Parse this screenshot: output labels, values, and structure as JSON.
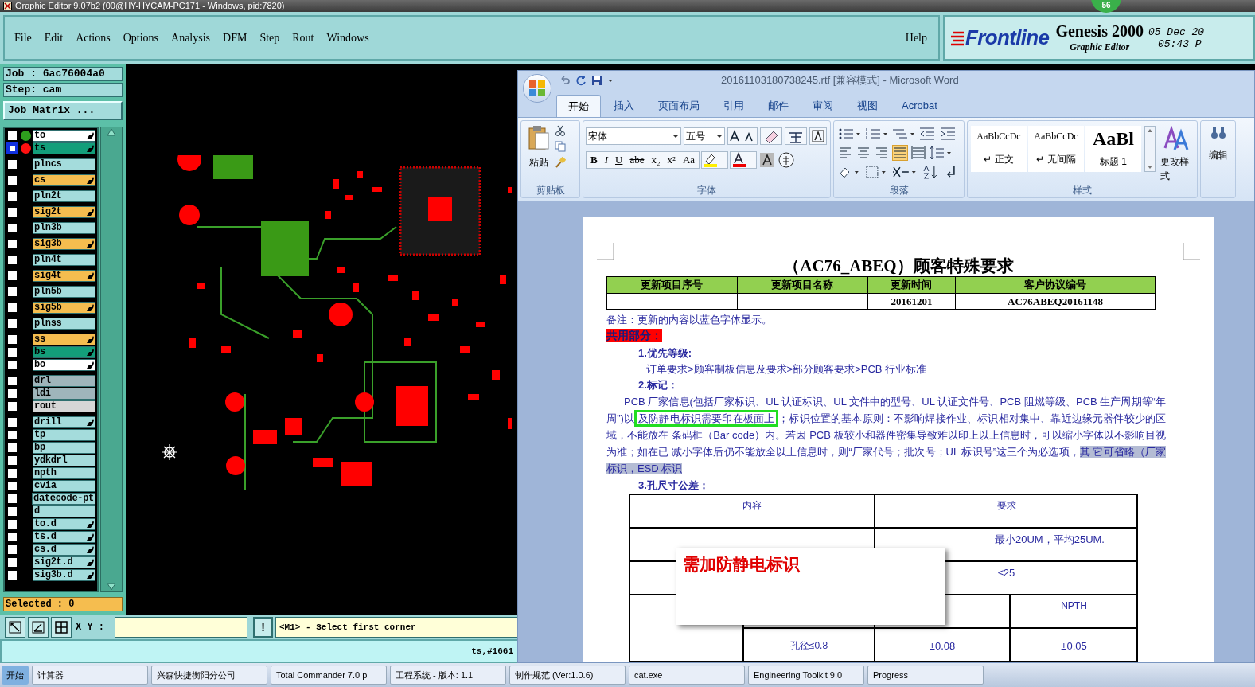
{
  "window": {
    "title": "Graphic Editor 9.07b2 (00@HY-HYCAM-PC171 - Windows, pid:7820)"
  },
  "menu": [
    "File",
    "Edit",
    "Actions",
    "Options",
    "Analysis",
    "DFM",
    "Step",
    "Rout",
    "Windows"
  ],
  "help": "Help",
  "brand": {
    "logo": "Frontline",
    "product": "Genesis 2000",
    "subtitle": "Graphic Editor",
    "date": "05 Dec 20",
    "time": "05:43 P",
    "badge": "56"
  },
  "job": "Job : 6ac76004a0",
  "step": "Step: cam",
  "job_matrix_button": "Job Matrix ...",
  "layer_groups": [
    {
      "layers": [
        {
          "name": "to",
          "kind": "silk",
          "color": "#2e9e1e",
          "flag": true,
          "selected": false
        },
        {
          "name": "ts",
          "kind": "mask",
          "color": "#ff1010",
          "flag": true,
          "selected": true
        }
      ]
    },
    {
      "layers": [
        {
          "name": "plncs",
          "kind": "plane",
          "flag": false,
          "selected": false
        }
      ]
    },
    {
      "layers": [
        {
          "name": "cs",
          "kind": "signal",
          "flag": true,
          "selected": false
        }
      ]
    },
    {
      "layers": [
        {
          "name": "pln2t",
          "kind": "plane",
          "flag": false,
          "selected": false
        }
      ]
    },
    {
      "layers": [
        {
          "name": "sig2t",
          "kind": "signal",
          "flag": true,
          "selected": false
        }
      ]
    },
    {
      "layers": [
        {
          "name": "pln3b",
          "kind": "plane",
          "flag": false,
          "selected": false
        }
      ]
    },
    {
      "layers": [
        {
          "name": "sig3b",
          "kind": "signal",
          "flag": true,
          "selected": false
        }
      ]
    },
    {
      "layers": [
        {
          "name": "pln4t",
          "kind": "plane",
          "flag": false,
          "selected": false
        }
      ]
    },
    {
      "layers": [
        {
          "name": "sig4t",
          "kind": "signal",
          "flag": true,
          "selected": false
        }
      ]
    },
    {
      "layers": [
        {
          "name": "pln5b",
          "kind": "plane",
          "flag": false,
          "selected": false
        }
      ]
    },
    {
      "layers": [
        {
          "name": "sig5b",
          "kind": "signal",
          "flag": true,
          "selected": false
        }
      ]
    },
    {
      "layers": [
        {
          "name": "plnss",
          "kind": "plane",
          "flag": false,
          "selected": false
        }
      ]
    },
    {
      "layers": [
        {
          "name": "ss",
          "kind": "signal",
          "flag": true,
          "selected": false
        },
        {
          "name": "bs",
          "kind": "mask",
          "flag": true,
          "selected": false
        },
        {
          "name": "bo",
          "kind": "silk",
          "flag": true,
          "selected": false
        }
      ]
    },
    {
      "layers": [
        {
          "name": "drl",
          "kind": "laser",
          "flag": false,
          "selected": false
        },
        {
          "name": "ldi",
          "kind": "laser",
          "flag": false,
          "selected": false
        },
        {
          "name": "rout",
          "kind": "rout",
          "flag": false,
          "selected": false
        }
      ]
    },
    {
      "layers": [
        {
          "name": "drill",
          "kind": "drill",
          "flag": true,
          "selected": false
        },
        {
          "name": "tp",
          "kind": "drill",
          "flag": false,
          "selected": false
        },
        {
          "name": "bp",
          "kind": "drill",
          "flag": false,
          "selected": false
        },
        {
          "name": "ydkdrl",
          "kind": "drill",
          "flag": false,
          "selected": false
        },
        {
          "name": "npth",
          "kind": "drill",
          "flag": false,
          "selected": false
        },
        {
          "name": "cvia",
          "kind": "drill",
          "flag": false,
          "selected": false
        },
        {
          "name": "datecode-pt",
          "kind": "drill",
          "flag": false,
          "selected": false
        },
        {
          "name": "d",
          "kind": "drill",
          "flag": false,
          "selected": false
        },
        {
          "name": "to.d",
          "kind": "drill",
          "flag": true,
          "selected": false
        },
        {
          "name": "ts.d",
          "kind": "drill",
          "flag": true,
          "selected": false
        },
        {
          "name": "cs.d",
          "kind": "drill",
          "flag": true,
          "selected": false
        },
        {
          "name": "sig2t.d",
          "kind": "drill",
          "flag": true,
          "selected": false
        },
        {
          "name": "sig3b.d",
          "kind": "drill",
          "flag": true,
          "selected": false
        }
      ]
    }
  ],
  "selected_count": "Selected : 0",
  "xy_label": "X Y :",
  "prompt_button": "!",
  "prompt": "<M1> - Select first corner",
  "status": "ts,#1661",
  "word": {
    "title": "20161103180738245.rtf [兼容模式] - Microsoft Word",
    "tabs": [
      {
        "label": "开始",
        "selected": true
      },
      {
        "label": "插入",
        "selected": false
      },
      {
        "label": "页面布局",
        "selected": false
      },
      {
        "label": "引用",
        "selected": false
      },
      {
        "label": "邮件",
        "selected": false
      },
      {
        "label": "审阅",
        "selected": false
      },
      {
        "label": "视图",
        "selected": false
      },
      {
        "label": "Acrobat",
        "selected": false
      }
    ],
    "paste": "粘贴",
    "font": "宋体",
    "size": "五号",
    "font_buttons": [
      "B",
      "I",
      "U",
      "abe",
      "x₂",
      "x²",
      "Aa"
    ],
    "styles": [
      {
        "preview": "AaBbCcDc",
        "name": "↵ 正文"
      },
      {
        "preview": "AaBbCcDc",
        "name": "↵ 无间隔"
      },
      {
        "preview": "AaBl",
        "name": "标题 1"
      }
    ],
    "change_styles": "更改样式",
    "edit": "编辑",
    "groups": [
      "剪贴板",
      "字体",
      "段落",
      "样式"
    ]
  },
  "document": {
    "title": "（AC76_ABEQ）顾客特殊要求",
    "update_table": {
      "columns": [
        "更新项目序号",
        "更新项目名称",
        "更新时间",
        "客户协议编号"
      ],
      "rows": [
        {
          "update_time": "20161201",
          "agreement_no": "AC76ABEQ20161148"
        }
      ]
    },
    "note": "备注：更新的内容以蓝色字体显示。",
    "section": "共用部分：",
    "priority_heading": "1.优先等级:",
    "priority_text": "订单要求>顾客制板信息及要求>部分顾客要求>PCB 行业标准",
    "marking_heading": "2.标记：",
    "marking_paragraph": [
      {
        "kind": "plain",
        "text": "PCB 厂家信息(包括厂家标识、UL 认证标识、UL 文件中的型号、UL 认证文件号、PCB 阻燃等级、PCB 生产周期等“年周”)以"
      },
      {
        "kind": "boxed",
        "text": "及防静电标识需要印在板面上"
      },
      {
        "kind": "plain",
        "text": "；标识位置的基本原则：不影响焊接作业、标识相对集中、靠近边缘元器件较少的区域，不能放在 条码框（Bar code）内。若因 PCB 板较小和器件密集导致难以印上以上信息时，可以缩小字体以不影响目视为准；如在已 减小字体后仍不能放全以上信息时，则“厂家代号；批次号；UL 标识号”这三个为必选项，"
      },
      {
        "kind": "highlighted",
        "text": "其 它可省略（厂家标识，ESD 标识"
      }
    ],
    "hole_heading": "3.孔尺寸公差：",
    "hole_table": {
      "content_header": "内容",
      "requirement_header": "要求",
      "min_plating": "最小20UM，平均25UM.",
      "limit": "≤25",
      "npth_header": "NPTH",
      "hole_size": "孔径≤0.8",
      "pth_tolerance": "±0.08",
      "npth_tolerance": "±0.05"
    }
  },
  "callout": "需加防静电标识",
  "taskbar": {
    "start": "开始",
    "items": [
      "计算器",
      "兴森快捷衡阳分公司",
      "Total Commander 7.0 p",
      "工程系统 - 版本: 1.1",
      "制作规范 (Ver:1.0.6)",
      "cat.exe",
      "Engineering Toolkit 9.0",
      "Progress"
    ]
  }
}
